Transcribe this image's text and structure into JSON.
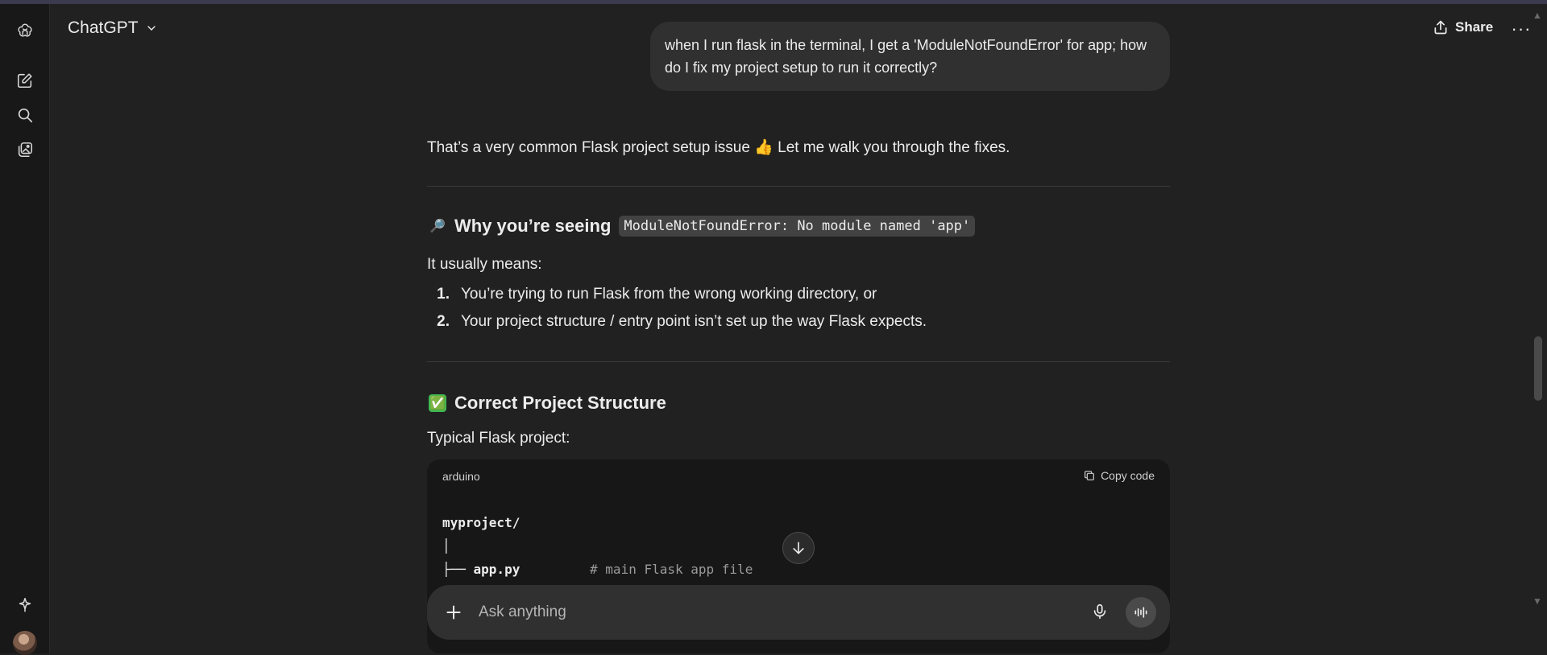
{
  "app": {
    "title": "ChatGPT"
  },
  "header": {
    "share_label": "Share",
    "more_label": "···"
  },
  "conversation": {
    "user_message": "when I run flask in the terminal, I get a 'ModuleNotFoundError' for app; how do I fix my project setup to run it correctly?",
    "intro": "That’s a very common Flask project setup issue 👍 Let me walk you through the fixes.",
    "section1": {
      "emoji": "🔎",
      "heading": "Why you’re seeing",
      "code": "ModuleNotFoundError: No module named 'app'",
      "lead": "It usually means:",
      "items": [
        {
          "num": "1.",
          "text": "You’re trying to run Flask from the wrong working directory, or"
        },
        {
          "num": "2.",
          "text": "Your project structure / entry point isn’t set up the way Flask expects."
        }
      ]
    },
    "section2": {
      "emoji": "✅",
      "heading": "Correct Project Structure",
      "lead": "Typical Flask project:"
    },
    "codeblock": {
      "language": "arduino",
      "copy_label": "Copy code",
      "line1": "myproject/",
      "line2": "│",
      "line3_tree": "├── ",
      "line3_file": "app.py",
      "line3_comment": "# main Flask app file"
    }
  },
  "composer": {
    "placeholder": "Ask anything"
  },
  "colors": {
    "background": "#212121",
    "sidebar": "#181818",
    "bubble": "#303030",
    "codeblock": "#171717"
  },
  "icons": {
    "logo": "openai-logo-icon",
    "new_chat": "new-chat-icon",
    "search": "search-icon",
    "library": "images-library-icon",
    "sparkle": "sparkle-icon",
    "share": "share-icon",
    "copy": "copy-icon",
    "arrow_down": "arrow-down-icon",
    "plus": "plus-icon",
    "mic": "mic-icon",
    "voice": "voice-mode-icon"
  }
}
